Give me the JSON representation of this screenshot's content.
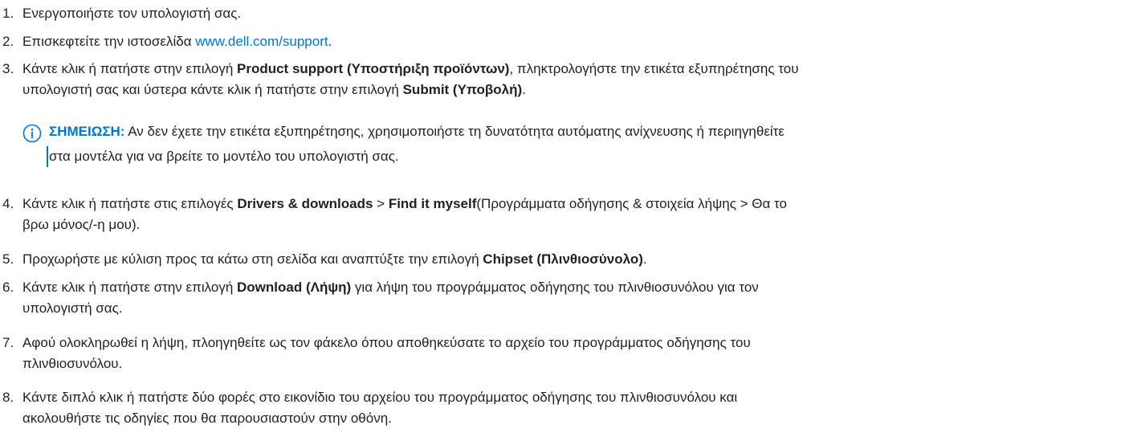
{
  "steps": [
    {
      "num": "1.",
      "text": "Ενεργοποιήστε τον υπολογιστή σας."
    },
    {
      "num": "2.",
      "pre": "Επισκεφτείτε την ιστοσελίδα ",
      "link": "www.dell.com/support",
      "post": "."
    },
    {
      "num": "3.",
      "t1": "Κάντε κλικ ή πατήστε στην επιλογή ",
      "b1": "Product support (Υποστήριξη προϊόντων)",
      "t2": ", πληκτρολογήστε την ετικέτα εξυπηρέτησης του",
      "t3": "υπολογιστή σας και ύστερα κάντε κλικ ή πατήστε στην επιλογή ",
      "b2": "Submit (Υποβολή)",
      "t4": "."
    },
    {
      "num": "4.",
      "t1": "Κάντε κλικ ή πατήστε στις επιλογές ",
      "b1": "Drivers & downloads",
      "t2": " > ",
      "b2": "Find it myself",
      "t3": "(Προγράμματα οδήγησης & στοιχεία λήψης > Θα το",
      "t4": "βρω μόνος/-η μου)."
    },
    {
      "num": "5.",
      "t1": "Προχωρήστε με κύλιση προς τα κάτω στη σελίδα και αναπτύξτε την επιλογή ",
      "b1": "Chipset (Πλινθιοσύνολο)",
      "t2": "."
    },
    {
      "num": "6.",
      "t1": "Κάντε κλικ ή πατήστε στην επιλογή ",
      "b1": "Download (Λήψη)",
      "t2": " για λήψη του προγράμματος οδήγησης του πλινθιοσυνόλου για τον",
      "t3": "υπολογιστή σας."
    },
    {
      "num": "7.",
      "t1": "Αφού ολοκληρωθεί η λήψη, πλοηγηθείτε ως τον φάκελο όπου αποθηκεύσατε το αρχείο του προγράμματος οδήγησης του",
      "t2": "πλινθιοσυνόλου."
    },
    {
      "num": "8.",
      "t1": "Κάντε διπλό κλικ ή πατήστε δύο φορές στο εικονίδιο του αρχείου του προγράμματος οδήγησης του πλινθιοσυνόλου και",
      "t2": "ακολουθήστε τις οδηγίες που θα παρουσιαστούν στην οθόνη."
    }
  ],
  "note": {
    "icon": "info-circle-icon",
    "label": "ΣΗΜΕΙΩΣΗ:",
    "line1": " Αν δεν έχετε την ετικέτα εξυπηρέτησης, χρησιμοποιήστε τη δυνατότητα αυτόματης ανίχνευσης ή περιηγηθείτε",
    "line2": "στα μοντέλα για να βρείτε το μοντέλο του υπολογιστή σας."
  },
  "colors": {
    "text": "#231f20",
    "accent": "#0076ce"
  }
}
